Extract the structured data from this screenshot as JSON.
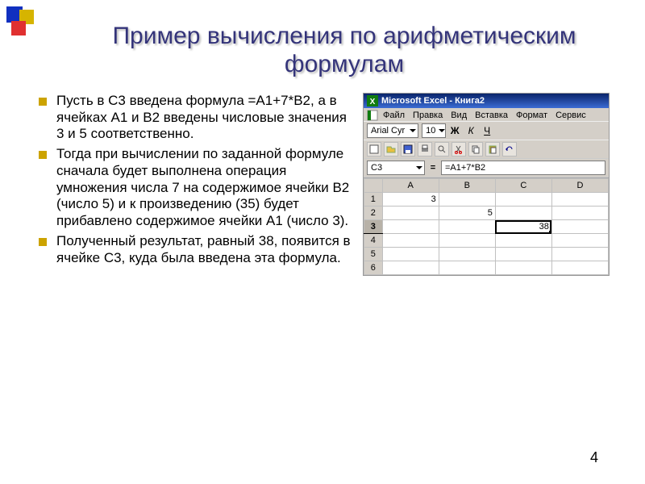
{
  "title": "Пример вычисления по арифметическим формулам",
  "bullets": [
    "Пусть в С3 введена формула =А1+7*В2, а в ячейках А1 и В2 введены числовые значения 3 и 5 соответственно.",
    "Тогда при вычислении по заданной формуле сначала будет выполнена операция умножения числа 7 на содержимое ячейки В2 (число 5) и к произведению (35) будет прибавлено содержимое ячейки А1 (число 3).",
    "Полученный результат, равный 38, появится в ячейке С3, куда была введена эта формула."
  ],
  "excel": {
    "window_title": "Microsoft Excel - Книга2",
    "menu": [
      "Файл",
      "Правка",
      "Вид",
      "Вставка",
      "Формат",
      "Сервис"
    ],
    "font_name": "Arial Cyr",
    "font_size": "10",
    "style_btns": {
      "bold": "Ж",
      "italic": "К",
      "underline": "Ч"
    },
    "name_box": "C3",
    "formula": "=A1+7*B2",
    "columns": [
      "A",
      "B",
      "C",
      "D"
    ],
    "rows": [
      {
        "h": "1",
        "cells": [
          "3",
          "",
          "",
          ""
        ]
      },
      {
        "h": "2",
        "cells": [
          "",
          "5",
          "",
          ""
        ]
      },
      {
        "h": "3",
        "cells": [
          "",
          "",
          "38",
          ""
        ],
        "sel": 2
      },
      {
        "h": "4",
        "cells": [
          "",
          "",
          "",
          ""
        ]
      },
      {
        "h": "5",
        "cells": [
          "",
          "",
          "",
          ""
        ]
      },
      {
        "h": "6",
        "cells": [
          "",
          "",
          "",
          ""
        ]
      }
    ]
  },
  "page_number": "4"
}
